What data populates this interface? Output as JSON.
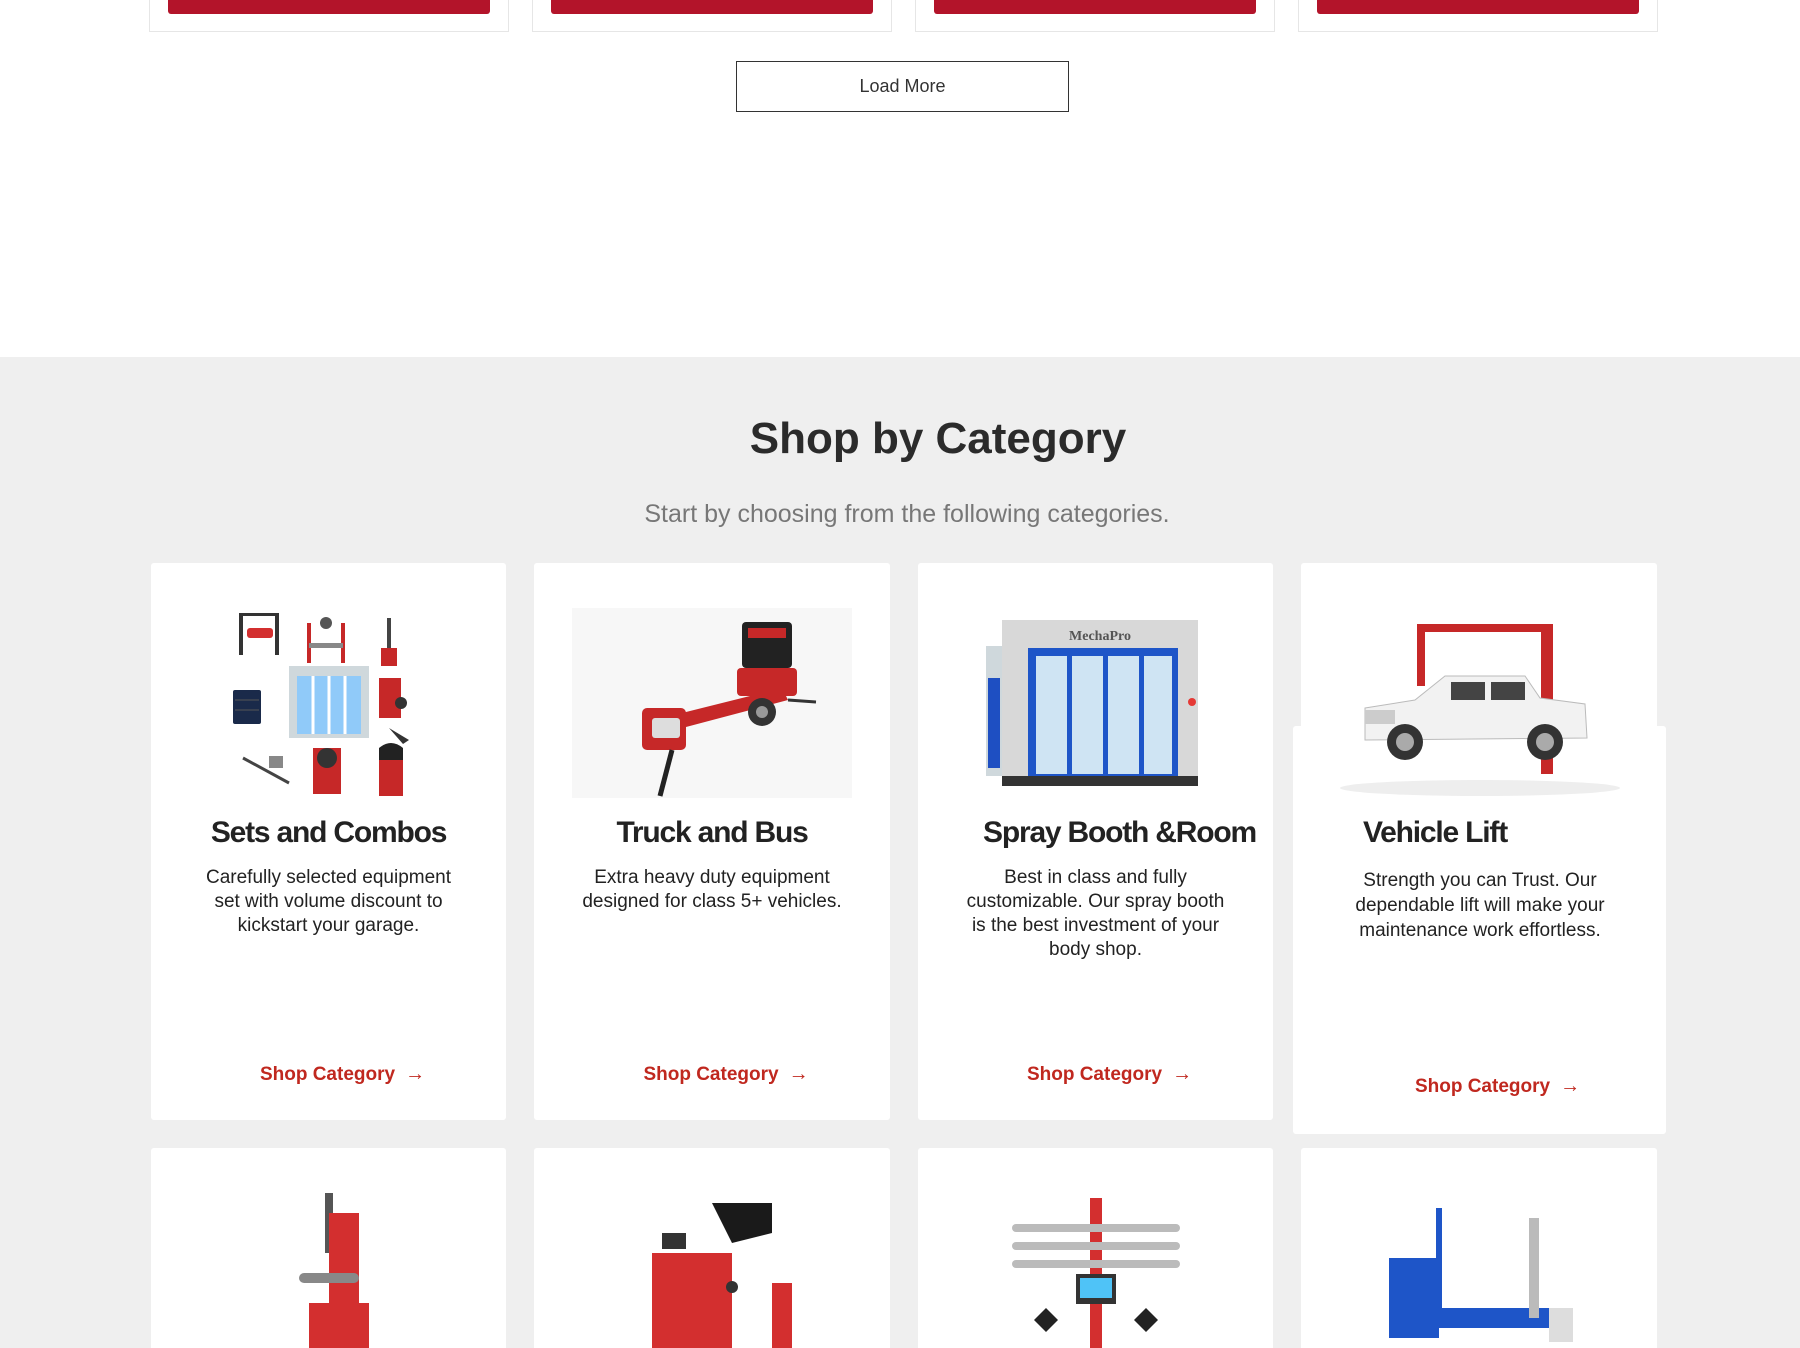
{
  "load_more": {
    "label": "Load More"
  },
  "category_section": {
    "title": "Shop by Category",
    "subtitle": "Start by choosing from the following categories.",
    "shop_label": "Shop Category",
    "arrow": "→",
    "cards": [
      {
        "title": "Sets and Combos",
        "description": "Carefully selected equipment set with volume discount to kickstart your garage."
      },
      {
        "title": "Truck and Bus",
        "description": "Extra heavy duty equipment designed for class 5+ vehicles."
      },
      {
        "title": "Spray Booth &Room",
        "description": "Best in class and fully customizable. Our spray booth is the best investment of your body shop."
      },
      {
        "title": "Vehicle Lift",
        "description": "Strength you can Trust. Our dependable lift will make your maintenance work effortless."
      }
    ],
    "spray_brand": "MechaPro"
  },
  "colors": {
    "brand_red": "#b3142a",
    "link_red": "#c0281f",
    "section_bg": "#efefef"
  }
}
